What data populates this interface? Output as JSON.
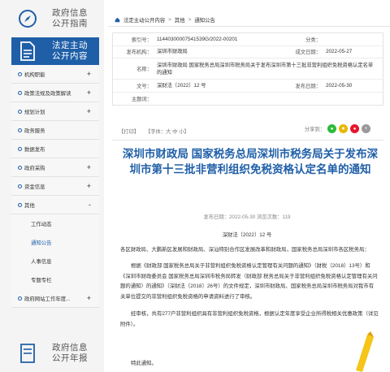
{
  "sidebar": {
    "guide": {
      "line1": "政府信息",
      "line2": "公开指南"
    },
    "active": {
      "line1": "法定主动",
      "line2": "公开内容"
    },
    "report": {
      "line1": "政府信息",
      "line2": "公开年报"
    },
    "items": [
      {
        "label": "机构职能",
        "plus": "+"
      },
      {
        "label": "政策法规及政策解读",
        "plus": "+"
      },
      {
        "label": "规划计划",
        "plus": "+"
      },
      {
        "label": "政务服务",
        "plus": ""
      },
      {
        "label": "数据发布",
        "plus": ""
      },
      {
        "label": "政府采购",
        "plus": "+"
      },
      {
        "label": "资金信息",
        "plus": "+"
      },
      {
        "label": "其他",
        "plus": "-"
      }
    ],
    "subitems": [
      "工作动态",
      "通知公告",
      "人事信息",
      "专题专栏"
    ],
    "last_item": {
      "label": "政府网站工作年度...",
      "plus": "+"
    }
  },
  "breadcrumb": [
    "法定主动公开内容",
    "其他",
    "通知公告"
  ],
  "meta": {
    "index_label": "索引号：",
    "index_value": "11440300007541539G/2022-00201",
    "category_label": "分类：",
    "category_value": "",
    "org_label": "发布机构：",
    "org_value": "深圳市财政局",
    "date_label": "成文日期：",
    "date_value": "2022-05-27",
    "name_label": "名称：",
    "name_value": "深圳市财政局 国家税务总局深圳市税务局关于发布深圳市第十三批非营利组织免税资格认定名单的通知",
    "docno_label": "文号：",
    "docno_value": "深财法〔2022〕12 号",
    "pubdate_label": "发布日期：",
    "pubdate_value": "2022-05-30",
    "subject_label": "主题词：",
    "subject_value": ""
  },
  "tools": {
    "print": "【打印】",
    "font": "【字体：大 中 小】"
  },
  "share_label": "分享到：",
  "article": {
    "title": "深圳市财政局 国家税务总局深圳市税务局关于发布深圳市第十三批非营利组织免税资格认定名单的通知",
    "pubinfo": "发布日期：2022-05-30    浏览次数：119",
    "docno": "深财法〔2022〕12 号",
    "p1": "各区财政局、大鹏新区发展和财政局、深汕特别合作区发展改革和财政局，国家税务总局深圳市各区税务局：",
    "p2": "根据《财政部 国家税务总局关于非营利组织免税资格认定管理有关问题的通知》（财税〔2018〕13号）和《深圳市财政委员会 国家税务总局深圳市税务局转发〈财政部 税务总局关于非营利组织免税资格认定管理有关问题的通知〉的通知》（深财法〔2018〕26号）的文件规定，深圳市财政局、国家税务总局深圳市税务局对我市有关单位提交的非营利组织免税资格的申请资料进行了审核。",
    "p3": "经审核，共有277户非营利组织具有非营利组织免税资格，根据认定年度享受企业所得税相关优惠政策（详见附件）。",
    "p4": "特此通知。"
  },
  "colors": {
    "primary": "#1f5fa8",
    "sidebar_bg": "#f4f4f4"
  }
}
